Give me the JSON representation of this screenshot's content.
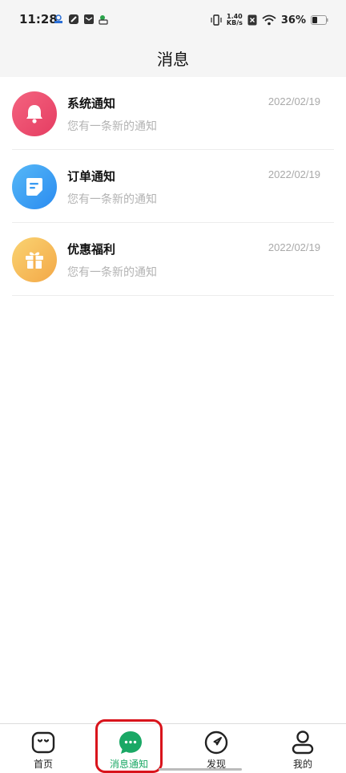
{
  "status_bar": {
    "time": "11:28",
    "net_speed_value": "1.40",
    "net_speed_unit": "KB/s",
    "battery": "36%"
  },
  "header": {
    "title": "消息"
  },
  "messages": [
    {
      "title": "系统通知",
      "subtitle": "您有一条新的通知",
      "date": "2022/02/19",
      "icon": "bell-icon",
      "color_from": "#f4527a",
      "color_to": "#e84e6a"
    },
    {
      "title": "订单通知",
      "subtitle": "您有一条新的通知",
      "date": "2022/02/19",
      "icon": "document-icon",
      "color_from": "#4aaef5",
      "color_to": "#2b8ff0"
    },
    {
      "title": "优惠福利",
      "subtitle": "您有一条新的通知",
      "date": "2022/02/19",
      "icon": "gift-icon",
      "color_from": "#f8c96a",
      "color_to": "#f2a94a"
    }
  ],
  "tabbar": {
    "tabs": [
      {
        "label": "首页",
        "icon": "home-face-icon",
        "active": false
      },
      {
        "label": "消息通知",
        "icon": "chat-bubble-icon",
        "active": true
      },
      {
        "label": "发现",
        "icon": "compass-navigate-icon",
        "active": false
      },
      {
        "label": "我的",
        "icon": "user-icon",
        "active": false
      }
    ],
    "active_color": "#1aa865",
    "highlight_color": "#d9141c"
  }
}
